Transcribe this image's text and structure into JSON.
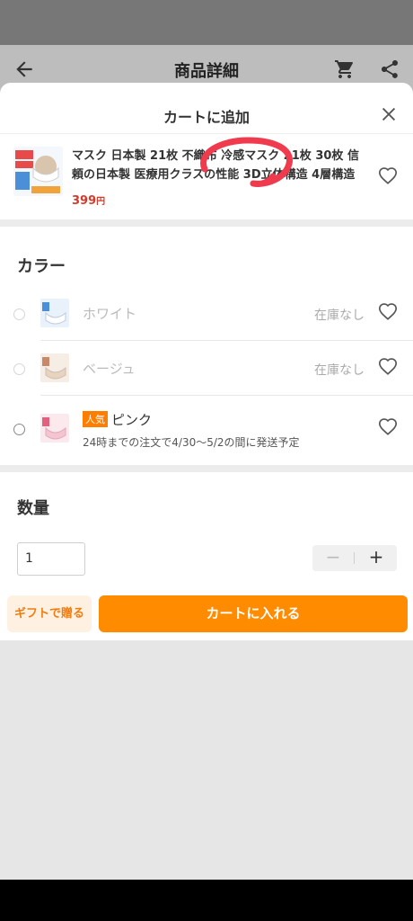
{
  "header": {
    "title": "商品詳細"
  },
  "sheet": {
    "title": "カートに追加"
  },
  "product": {
    "name": "マスク 日本製 21枚 不織布 冷感マスク 21枚 30枚 信頼の日本製 医療用クラスの性能 3D立体構造 4層構造 メ…",
    "price": "399",
    "currency": "円"
  },
  "color": {
    "title": "カラー",
    "options": [
      {
        "label": "ホワイト",
        "stock": "在庫なし"
      },
      {
        "label": "ベージュ",
        "stock": "在庫なし"
      },
      {
        "label": "ピンク",
        "badge": "人気",
        "shipping": "24時までの注文で4/30〜5/2の間に発送予定"
      }
    ]
  },
  "quantity": {
    "title": "数量",
    "value": "1",
    "minus": "−",
    "plus": "+"
  },
  "footer": {
    "gift_label": "ギフトで贈る",
    "cart_label": "カートに入れる"
  },
  "colors": {
    "accent": "#ff8b00",
    "price": "#d23a2a",
    "annotation": "#f03a4e"
  }
}
